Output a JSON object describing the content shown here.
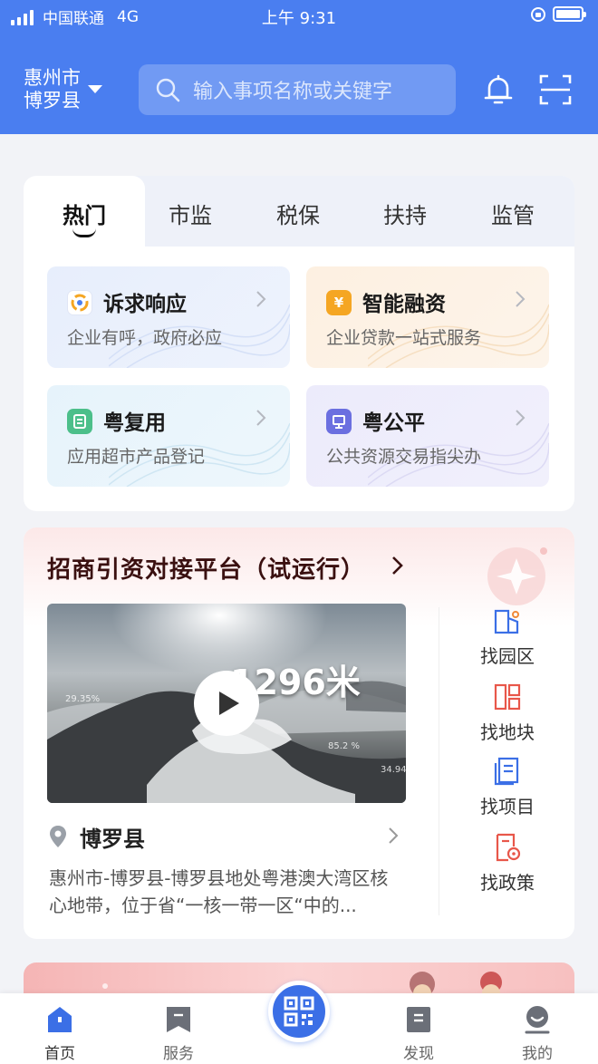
{
  "status_bar": {
    "carrier": "中国联通",
    "network": "4G",
    "time": "上午 9:31"
  },
  "header": {
    "city_line1": "惠州市",
    "city_line2": "博罗县",
    "search_placeholder": "输入事项名称或关键字",
    "icons": [
      "search-icon",
      "bell-icon",
      "scan-icon"
    ]
  },
  "service_tabs": [
    {
      "label": "热门",
      "active": true
    },
    {
      "label": "市监"
    },
    {
      "label": "税保"
    },
    {
      "label": "扶持"
    },
    {
      "label": "监管"
    }
  ],
  "services": [
    {
      "title": "诉求响应",
      "desc": "企业有呼，政府必应",
      "icon": "response-icon",
      "color": "#f5a623"
    },
    {
      "title": "智能融资",
      "desc": "企业贷款一站式服务",
      "icon": "yuan-icon",
      "color": "#f5a623"
    },
    {
      "title": "粤复用",
      "desc": "应用超市产品登记",
      "icon": "reuse-icon",
      "color": "#4cbf8a"
    },
    {
      "title": "粤公平",
      "desc": "公共资源交易指尖办",
      "icon": "fair-icon",
      "color": "#6b6fe0"
    }
  ],
  "investment": {
    "title": "招商引资对接平台（试运行）",
    "video_overlay": "1296米",
    "video_small_labels": [
      "29.35%",
      "85.2 %",
      "34.94"
    ],
    "location_name": "博罗县",
    "location_desc": "惠州市-博罗县-博罗县地处粤港澳大湾区核心地带，位于省“一核一带一区“中的...",
    "side_links": [
      {
        "label": "找园区",
        "icon": "park-icon"
      },
      {
        "label": "找地块",
        "icon": "land-icon"
      },
      {
        "label": "找项目",
        "icon": "project-icon"
      },
      {
        "label": "找政策",
        "icon": "policy-icon"
      }
    ]
  },
  "bottom_nav": {
    "items": [
      {
        "label": "首页",
        "icon": "home-icon",
        "active": true
      },
      {
        "label": "服务",
        "icon": "service-icon"
      },
      {
        "label": "发现",
        "icon": "discover-icon"
      },
      {
        "label": "我的",
        "icon": "profile-icon"
      }
    ],
    "center_icon": "qr-code-icon"
  },
  "colors": {
    "header_blue": "#4a7ef0",
    "accent_blue": "#3b6fe6",
    "invest_title": "#3a1010"
  }
}
